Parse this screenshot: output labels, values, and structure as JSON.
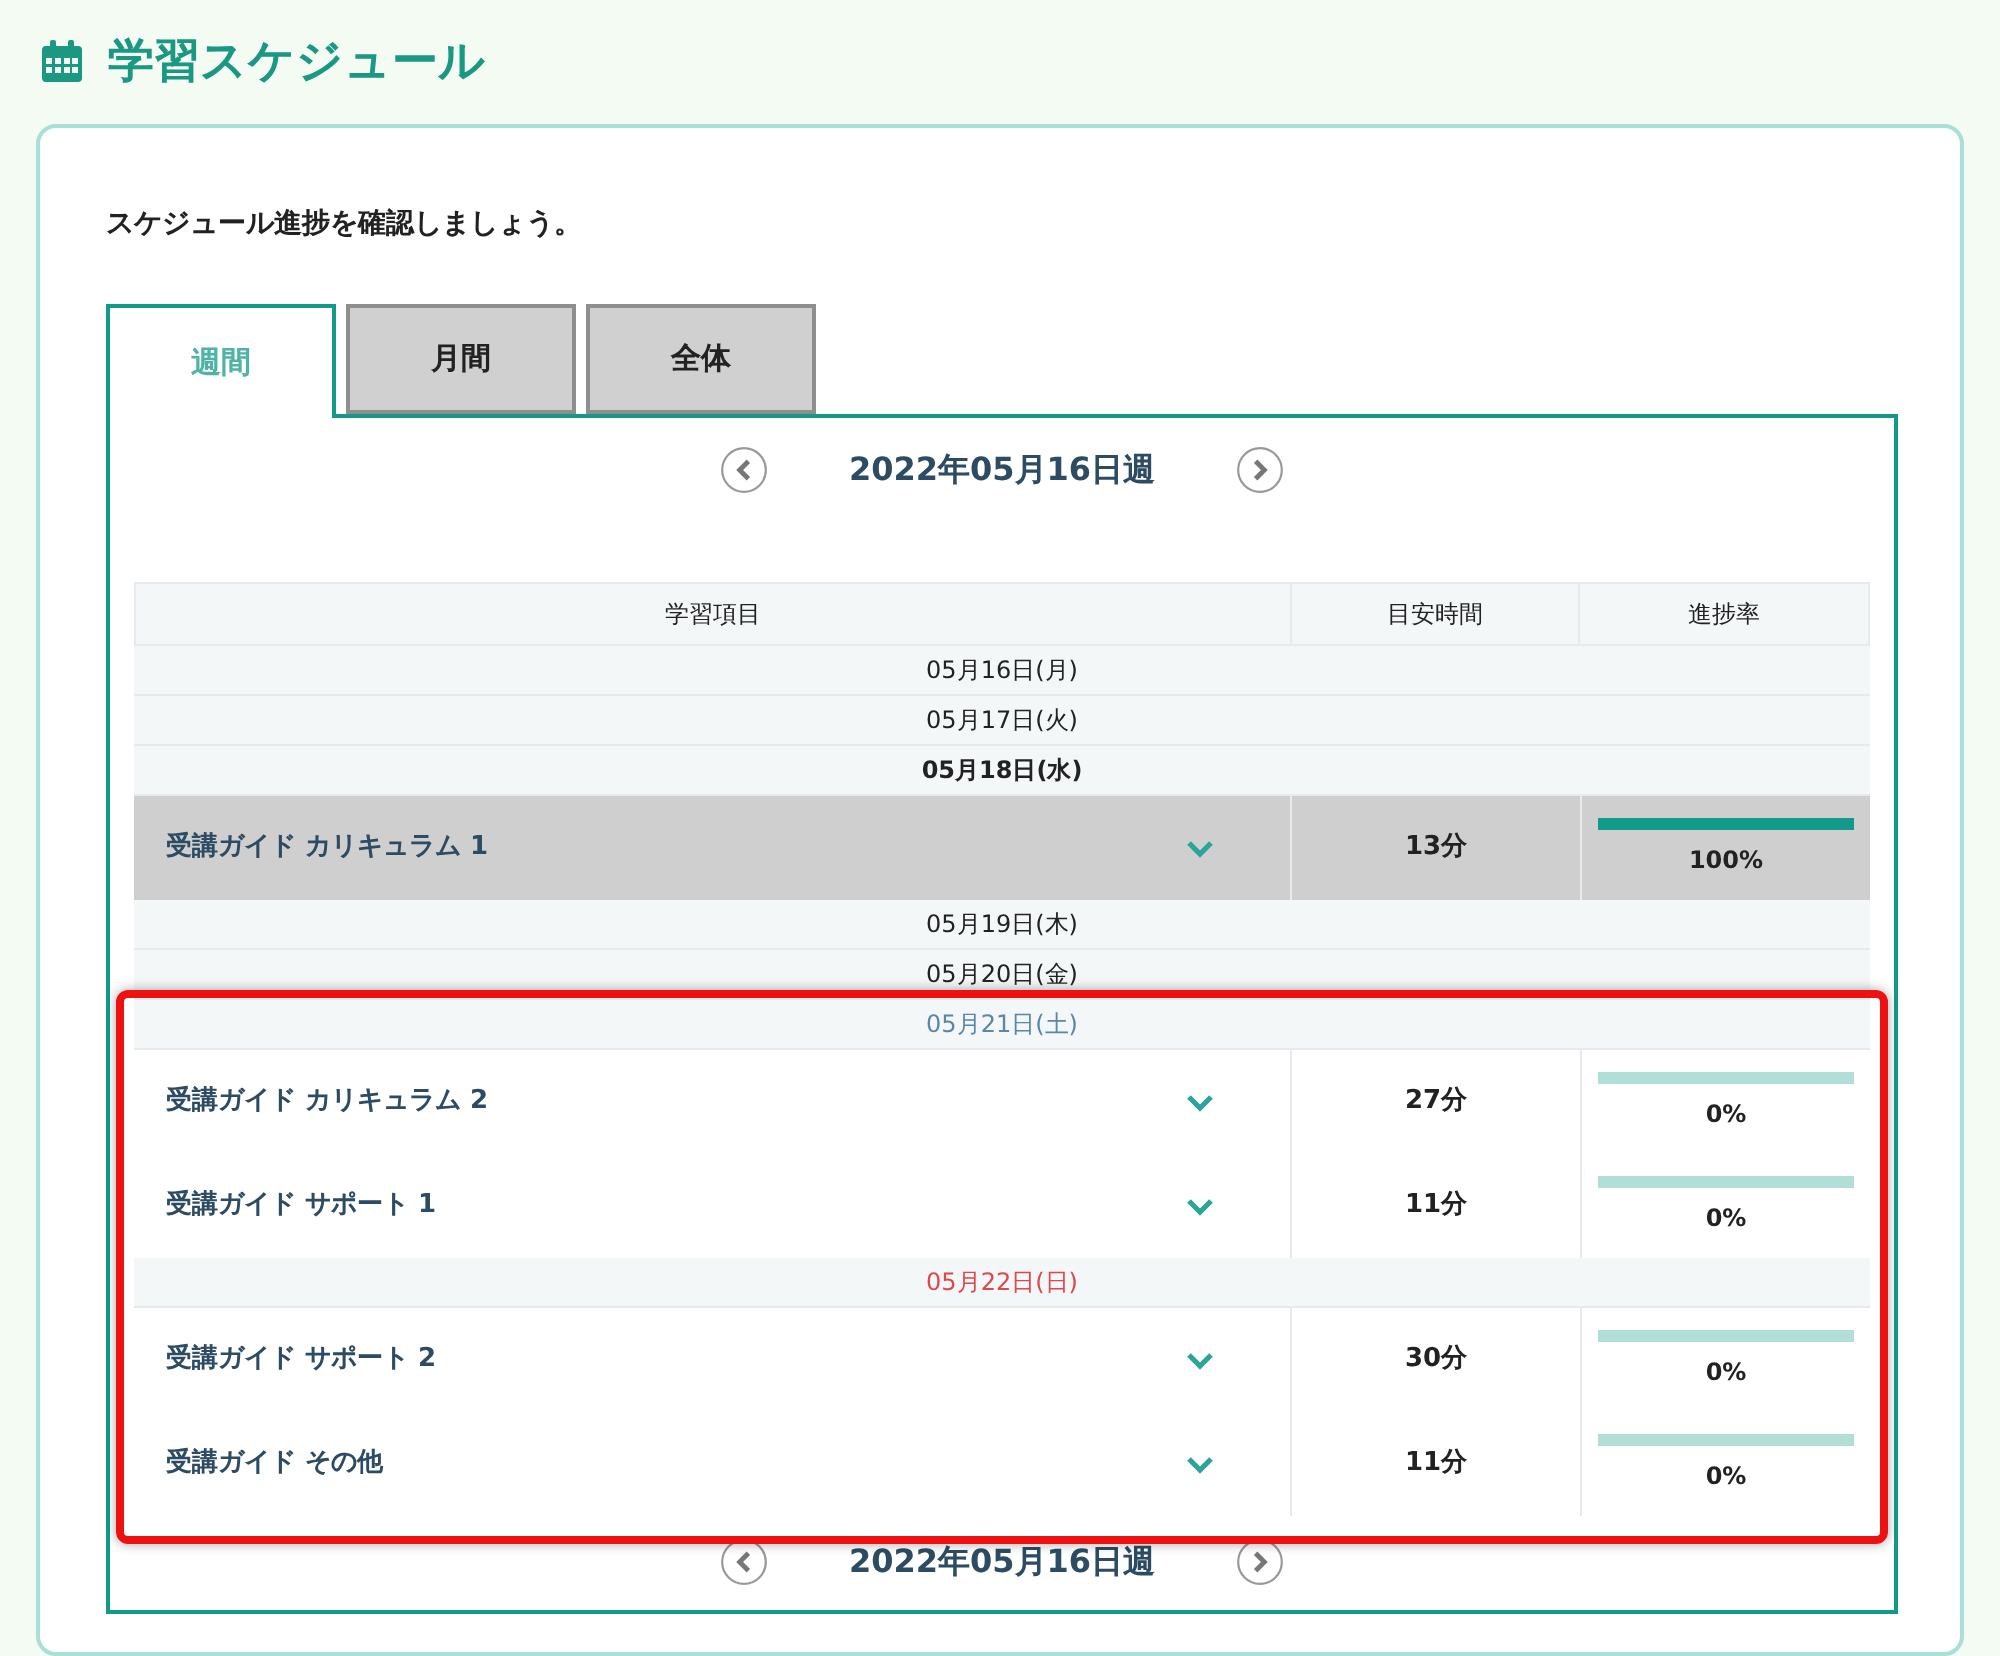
{
  "page_title": "学習スケジュール",
  "intro": "スケジュール進捗を確認しましょう。",
  "tabs": [
    {
      "label": "週間",
      "selected": true
    },
    {
      "label": "月間",
      "selected": false
    },
    {
      "label": "全体",
      "selected": false
    }
  ],
  "week_nav_top": {
    "label": "2022年05月16日週"
  },
  "table": {
    "columns": [
      "学習項目",
      "目安時間",
      "進捗率"
    ],
    "days": [
      {
        "date": "05月16日(月)",
        "kind": "weekday",
        "today": false,
        "highlighted": false
      },
      {
        "date": "05月17日(火)",
        "kind": "weekday",
        "today": false,
        "highlighted": false
      },
      {
        "date": "05月18日(水)",
        "kind": "weekday",
        "today": true,
        "highlighted": false,
        "items": [
          {
            "title": "受講ガイド カリキュラム 1",
            "time": "13分",
            "level": 1,
            "percent": "100%"
          }
        ]
      },
      {
        "date": "05月19日(木)",
        "kind": "weekday",
        "today": false,
        "highlighted": false
      },
      {
        "date": "05月20日(金)",
        "kind": "weekday",
        "today": false,
        "highlighted": false
      },
      {
        "date": "05月21日(土)",
        "kind": "saturday",
        "today": false,
        "highlighted": true,
        "items": [
          {
            "title": "受講ガイド カリキュラム 2",
            "time": "27分",
            "level": 0,
            "percent": "0%"
          },
          {
            "title": "受講ガイド サポート 1",
            "time": "11分",
            "level": 0,
            "percent": "0%"
          }
        ]
      },
      {
        "date": "05月22日(日)",
        "kind": "sunday",
        "today": false,
        "highlighted": true,
        "items": [
          {
            "title": "受講ガイド サポート 2",
            "time": "30分",
            "level": 0,
            "percent": "0%"
          },
          {
            "title": "受講ガイド その他",
            "time": "11分",
            "level": 0,
            "percent": "0%"
          }
        ]
      }
    ]
  },
  "week_nav_bottom": {
    "label": "2022年05月16日週"
  }
}
